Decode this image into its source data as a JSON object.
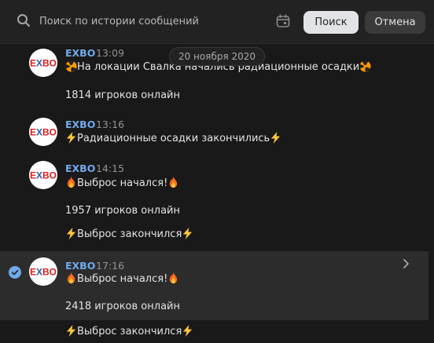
{
  "search": {
    "placeholder": "Поиск по истории сообщений",
    "search_button": "Поиск",
    "cancel_button": "Отмена"
  },
  "date_separator": "20 ноября 2020",
  "messages": [
    {
      "author": "EXBO",
      "time": "13:09",
      "lines": [
        "На локации Свалка начались радиационные осадки",
        "1814 игроков онлайн"
      ]
    },
    {
      "author": "EXBO",
      "time": "13:16",
      "lines": [
        "Радиационные осадки закончились"
      ]
    },
    {
      "author": "EXBO",
      "time": "14:15",
      "lines": [
        "Выброс начался!",
        "1957 игроков онлайн",
        "Выброс закончился"
      ]
    },
    {
      "author": "EXBO",
      "time": "17:16",
      "selected": true,
      "lines": [
        "Выброс начался!",
        "2418 игроков онлайн",
        "Выброс закончился"
      ]
    }
  ],
  "icons": {
    "search": "search-icon",
    "calendar": "calendar-icon",
    "radiation": "radiation-icon",
    "lightning": "lightning-icon",
    "fire": "fire-icon",
    "check": "check-icon",
    "chevron": "chevron-right-icon"
  },
  "colors": {
    "accent": "#71aaeb",
    "radiation": "#ff9900",
    "lightning": "#ffc83d",
    "fire": "#ff6b1a"
  }
}
